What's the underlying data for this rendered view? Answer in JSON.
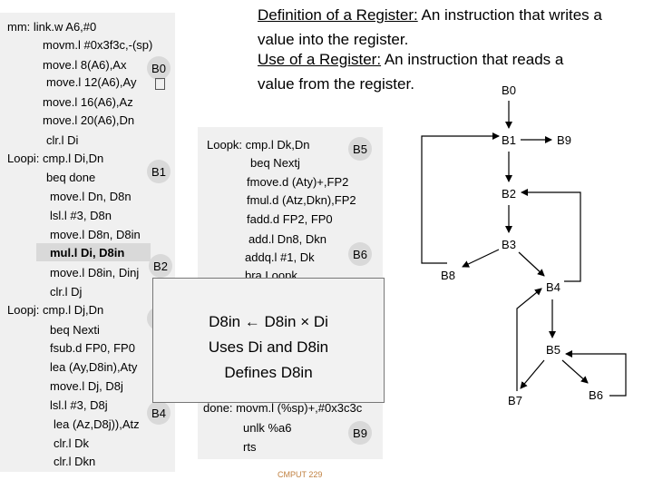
{
  "definition": {
    "def_term": "Definition of a Register:",
    "def_text": " An instruction that writes a",
    "def_text2": "value into the register.",
    "use_term": "Use of a Register:",
    "use_text": " An instruction that reads a",
    "use_text2": "value from the register."
  },
  "left_code": [
    "mm: link.w A6,#0",
    "movm.l #0x3f3c,-(sp)",
    "move.l 8(A6),Ax",
    "move.l 12(A6),Ay",
    "move.l 16(A6),Az",
    "move.l 20(A6),Dn",
    "clr.l Di",
    "Loopi: cmp.l Di,Dn",
    "beq done",
    "move.l Dn, D8n",
    "lsl.l #3, D8n",
    "move.l D8n, D8in",
    "mul.l  Di, D8in",
    "move.l D8in, Dinj",
    "clr.l Dj",
    "Loopj: cmp.l Dj,Dn",
    "beq   Nexti",
    "fsub.d  FP0, FP0",
    "lea   (Ay,D8in),Aty",
    "move.l Dj, D8j",
    "lsl.l #3, D8j",
    "lea (Az,D8j)),Atz",
    "clr.l Dk",
    "clr.l  Dkn"
  ],
  "right_code": [
    "Loopk:  cmp.l Dk,Dn",
    "beq   Nextj",
    "fmove.d (Aty)+,FP2",
    "fmul.d (Atz,Dkn),FP2",
    "fadd.d FP2, FP0",
    "add.l  Dn8, Dkn",
    "addq.l #1, Dk",
    "bra     Loopk",
    "done:   movm.l (%sp)+,#0x3c3c",
    "unlk %a6",
    "rts"
  ],
  "code_badges": {
    "b0": "B0",
    "b1": "B1",
    "b2": "B2",
    "b4": "B4",
    "b5": "B5",
    "b6": "B6",
    "b9": "B9"
  },
  "popup": {
    "line1": "D8in ← D8in × Di",
    "line2": "Uses Di and D8in",
    "line3": "Defines D8in"
  },
  "cfg": {
    "B0": "B0",
    "B1": "B1",
    "B2": "B2",
    "B3": "B3",
    "B4": "B4",
    "B5": "B5",
    "B6": "B6",
    "B7": "B7",
    "B8": "B8",
    "B9": "B9"
  },
  "footer": "CMPUT 229"
}
